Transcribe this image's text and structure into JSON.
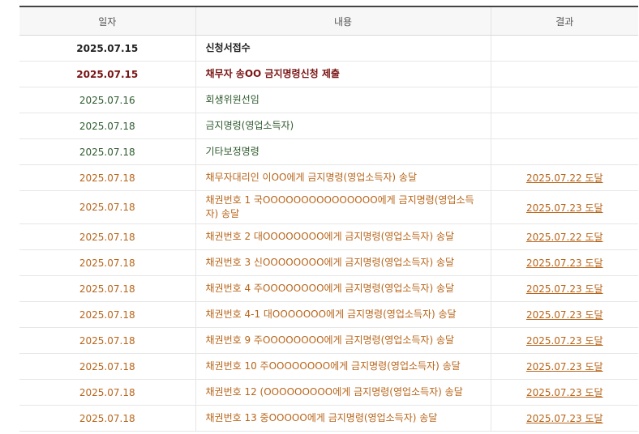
{
  "header": {
    "date": "일자",
    "content": "내용",
    "result": "결과"
  },
  "rows": [
    {
      "date": "2025.07.15",
      "content": "신청서접수",
      "result": ""
    },
    {
      "date": "2025.07.15",
      "content": "채무자 송OO 금지명령신청 제출",
      "result": ""
    },
    {
      "date": "2025.07.16",
      "content": "회생위원선임",
      "result": ""
    },
    {
      "date": "2025.07.18",
      "content": "금지명령(영업소득자)",
      "result": ""
    },
    {
      "date": "2025.07.18",
      "content": "기타보정명령",
      "result": ""
    },
    {
      "date": "2025.07.18",
      "content": "채무자대리인 이OO에게 금지명령(영업소득자) 송달",
      "result": "2025.07.22 도달"
    },
    {
      "date": "2025.07.18",
      "content": "채권번호 1 국OOOOOOOOOOOOOOO에게 금지명령(영업소득자) 송달",
      "result": "2025.07.23 도달"
    },
    {
      "date": "2025.07.18",
      "content": "채권번호 2 대OOOOOOOO에게 금지명령(영업소득자) 송달",
      "result": "2025.07.22 도달"
    },
    {
      "date": "2025.07.18",
      "content": "채권번호 3 신OOOOOOOO에게 금지명령(영업소득자) 송달",
      "result": "2025.07.23 도달"
    },
    {
      "date": "2025.07.18",
      "content": "채권번호 4 주OOOOOOOO에게 금지명령(영업소득자) 송달",
      "result": "2025.07.23 도달"
    },
    {
      "date": "2025.07.18",
      "content": "채권번호 4-1 대OOOOOOO에게 금지명령(영업소득자) 송달",
      "result": "2025.07.23 도달"
    },
    {
      "date": "2025.07.18",
      "content": "채권번호 9 주OOOOOOOO에게 금지명령(영업소득자) 송달",
      "result": "2025.07.23 도달"
    },
    {
      "date": "2025.07.18",
      "content": "채권번호 10 주OOOOOOOO에게 금지명령(영업소득자) 송달",
      "result": "2025.07.23 도달"
    },
    {
      "date": "2025.07.18",
      "content": "채권번호 12 (OOOOOOOOO에게 금지명령(영업소득자) 송달",
      "result": "2025.07.23 도달"
    },
    {
      "date": "2025.07.18",
      "content": "채권번호 13 중OOOOO에게 금지명령(영업소득자) 송달",
      "result": "2025.07.23 도달"
    }
  ]
}
